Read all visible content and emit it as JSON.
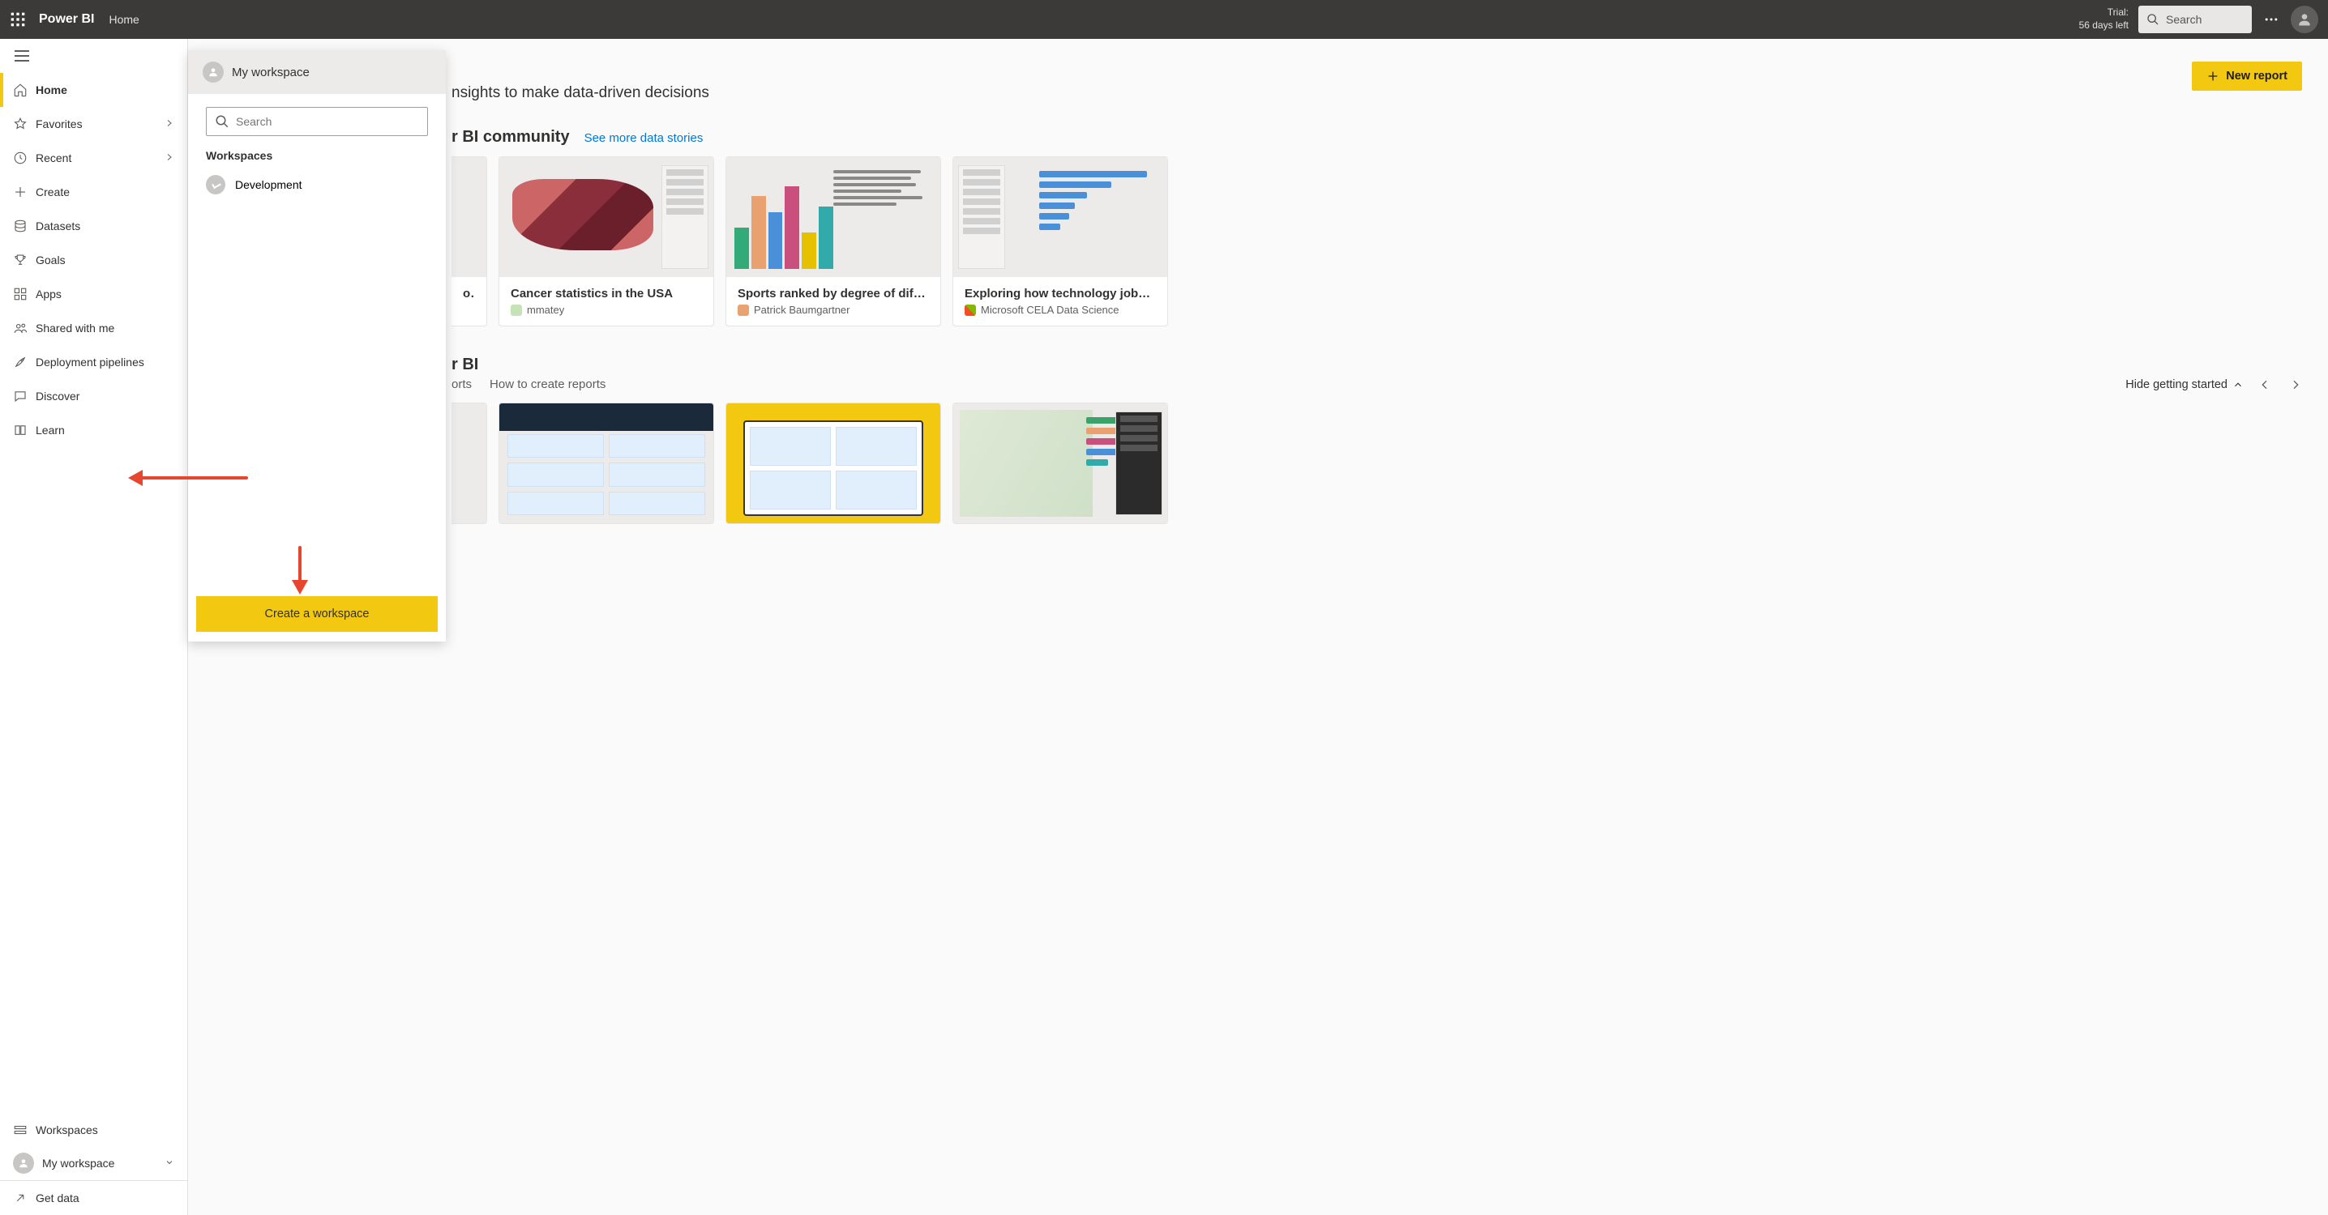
{
  "header": {
    "brand": "Power BI",
    "crumb": "Home",
    "trial_line1": "Trial:",
    "trial_line2": "56 days left",
    "search_placeholder": "Search"
  },
  "nav": {
    "items": [
      {
        "key": "home",
        "label": "Home",
        "active": true,
        "chevron": false
      },
      {
        "key": "favorites",
        "label": "Favorites",
        "chevron": true
      },
      {
        "key": "recent",
        "label": "Recent",
        "chevron": true
      },
      {
        "key": "create",
        "label": "Create",
        "chevron": false
      },
      {
        "key": "datasets",
        "label": "Datasets",
        "chevron": false
      },
      {
        "key": "goals",
        "label": "Goals",
        "chevron": false
      },
      {
        "key": "apps",
        "label": "Apps",
        "chevron": false
      },
      {
        "key": "shared",
        "label": "Shared with me",
        "chevron": false
      },
      {
        "key": "pipelines",
        "label": "Deployment pipelines",
        "chevron": false
      },
      {
        "key": "discover",
        "label": "Discover",
        "chevron": false
      },
      {
        "key": "learn",
        "label": "Learn",
        "chevron": false
      }
    ],
    "workspaces_label": "Workspaces",
    "my_workspace_label": "My workspace",
    "get_data_label": "Get data"
  },
  "flyout": {
    "header": "My workspace",
    "search_placeholder": "Search",
    "section_label": "Workspaces",
    "items": [
      {
        "label": "Development"
      }
    ],
    "create_label": "Create a workspace"
  },
  "main": {
    "subhead_partial": "nsights to make data-driven decisions",
    "new_report_label": "New report",
    "community": {
      "title_partial": "r BI community",
      "see_more": "See more data stories",
      "cards": [
        {
          "title": "o...",
          "author": ""
        },
        {
          "title": "Cancer statistics in the USA",
          "author": "mmatey",
          "dot": "dot-c1"
        },
        {
          "title": "Sports ranked by degree of diffi...",
          "author": "Patrick Baumgartner",
          "dot": "dot-c2"
        },
        {
          "title": "Exploring how technology jobs ...",
          "author": "Microsoft CELA Data Science",
          "dot": "dot-c3"
        }
      ]
    },
    "getting_started": {
      "title_partial": "r BI",
      "tabs": [
        "orts",
        "How to create reports"
      ],
      "hide_label": "Hide getting started"
    }
  }
}
